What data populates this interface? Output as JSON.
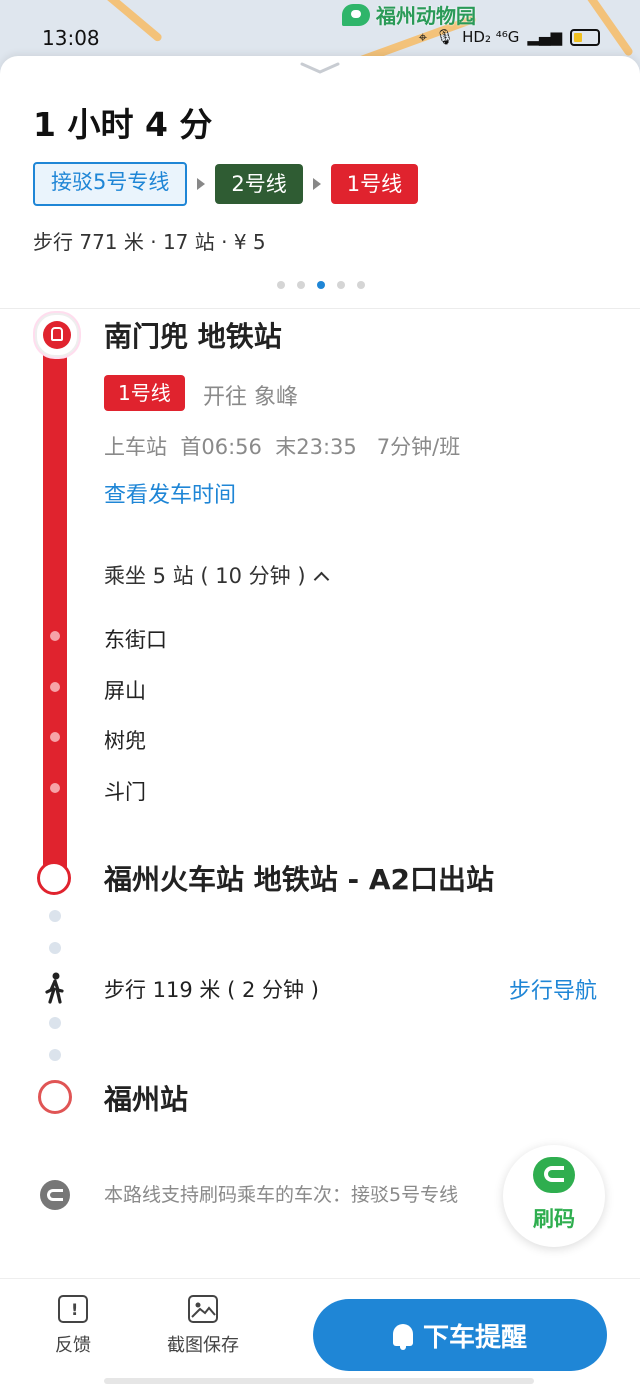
{
  "status_bar": {
    "time": "13:08",
    "indicators": "HD₂ ⁴⁶G"
  },
  "map": {
    "poi_label": "福州动物园"
  },
  "summary": {
    "duration": "1 小时 4 分",
    "chips": [
      {
        "label": "接驳5号专线",
        "style": "outline",
        "color": "#1f86d6"
      },
      {
        "label": "2号线",
        "style": "solid",
        "color": "#2f5c33"
      },
      {
        "label": "1号线",
        "style": "solid",
        "color": "#e0232e"
      }
    ],
    "stats": "步行 771 米 · 17 站 · ¥ 5",
    "page_indicator": {
      "count": 5,
      "active": 2
    }
  },
  "segment_metro": {
    "board_station": "南门兜 地铁站",
    "line_badge": "1号线",
    "direction": "开往 象峰",
    "schedule": "上车站  首06:56  末23:35   7分钟/班",
    "timetable_link": "查看发车时间",
    "ride_summary": "乘坐 5 站 ( 10 分钟 )",
    "stops": [
      "东街口",
      "屏山",
      "树兜",
      "斗门"
    ],
    "alight_station": "福州火车站 地铁站 - A2口出站"
  },
  "segment_walk": {
    "text": "步行 119 米 ( 2 分钟 )",
    "nav_link": "步行导航"
  },
  "destination": {
    "name": "福州站"
  },
  "pay_note": "本路线支持刷码乘车的车次：接驳5号专线",
  "fab": {
    "label": "刷码"
  },
  "bottom_bar": {
    "feedback": "反馈",
    "screenshot_save": "截图保存",
    "cta": "下车提醒"
  },
  "colors": {
    "accent": "#1f86d6",
    "line1": "#e0232e",
    "line2": "#2f5c33",
    "pay_green": "#2fae4f"
  }
}
